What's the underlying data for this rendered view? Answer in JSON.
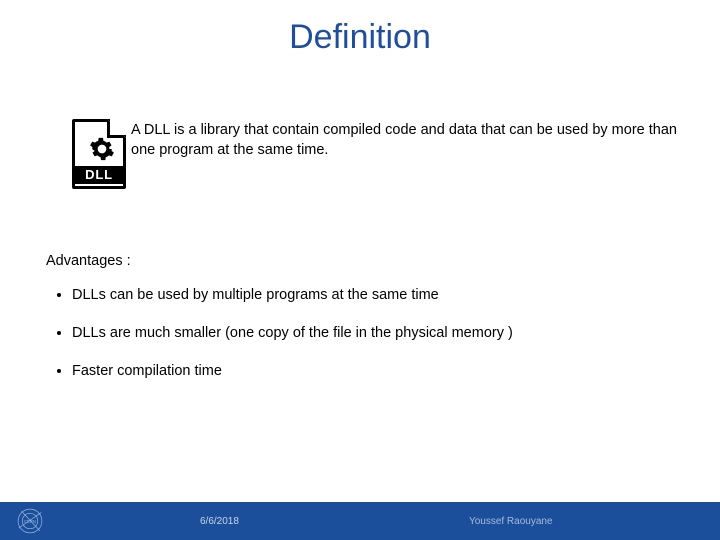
{
  "title": "Definition",
  "intro": "A DLL is a library that contain compiled code and data that can be used by more than one program at the same time.",
  "icon_label": "DLL",
  "advantages_heading": "Advantages :",
  "advantages": [
    "DLLs can be used by multiple programs at the same time",
    "DLLs are much smaller (one copy of the file in the physical memory )",
    "Faster compilation time"
  ],
  "footer": {
    "date": "6/6/2018",
    "author": "Youssef Raouyane",
    "logo_name": "CERN"
  },
  "colors": {
    "accent": "#1f4e9c",
    "footer_bg": "#1b4f9b"
  }
}
